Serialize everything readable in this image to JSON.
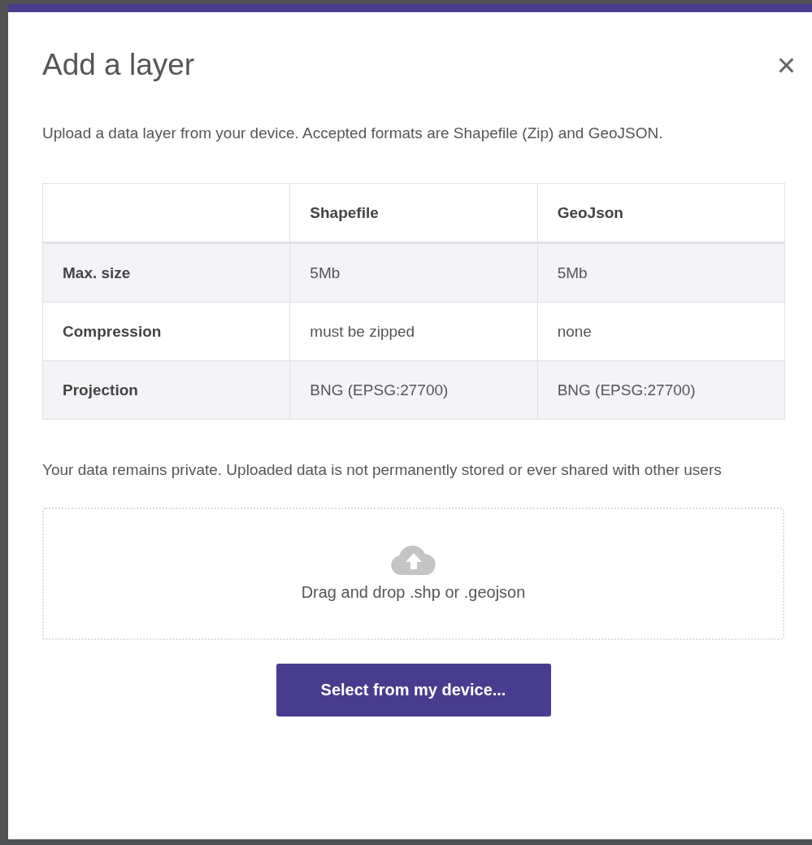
{
  "dialog": {
    "title": "Add a layer",
    "close": "×",
    "intro": "Upload a data layer from your device. Accepted formats are Shapefile (Zip) and GeoJSON.",
    "table": {
      "columns": [
        "Shapefile",
        "GeoJson"
      ],
      "rows": [
        {
          "label": "Max. size",
          "cells": [
            "5Mb",
            "5Mb"
          ]
        },
        {
          "label": "Compression",
          "cells": [
            "must be zipped",
            "none"
          ]
        },
        {
          "label": "Projection",
          "cells": [
            "BNG (EPSG:27700)",
            "BNG (EPSG:27700)"
          ]
        }
      ]
    },
    "privacy": "Your data remains private. Uploaded data is not permanently stored or ever shared with other users",
    "dropzone": {
      "text": "Drag and drop .shp or .geojson"
    },
    "button": "Select from my device..."
  }
}
